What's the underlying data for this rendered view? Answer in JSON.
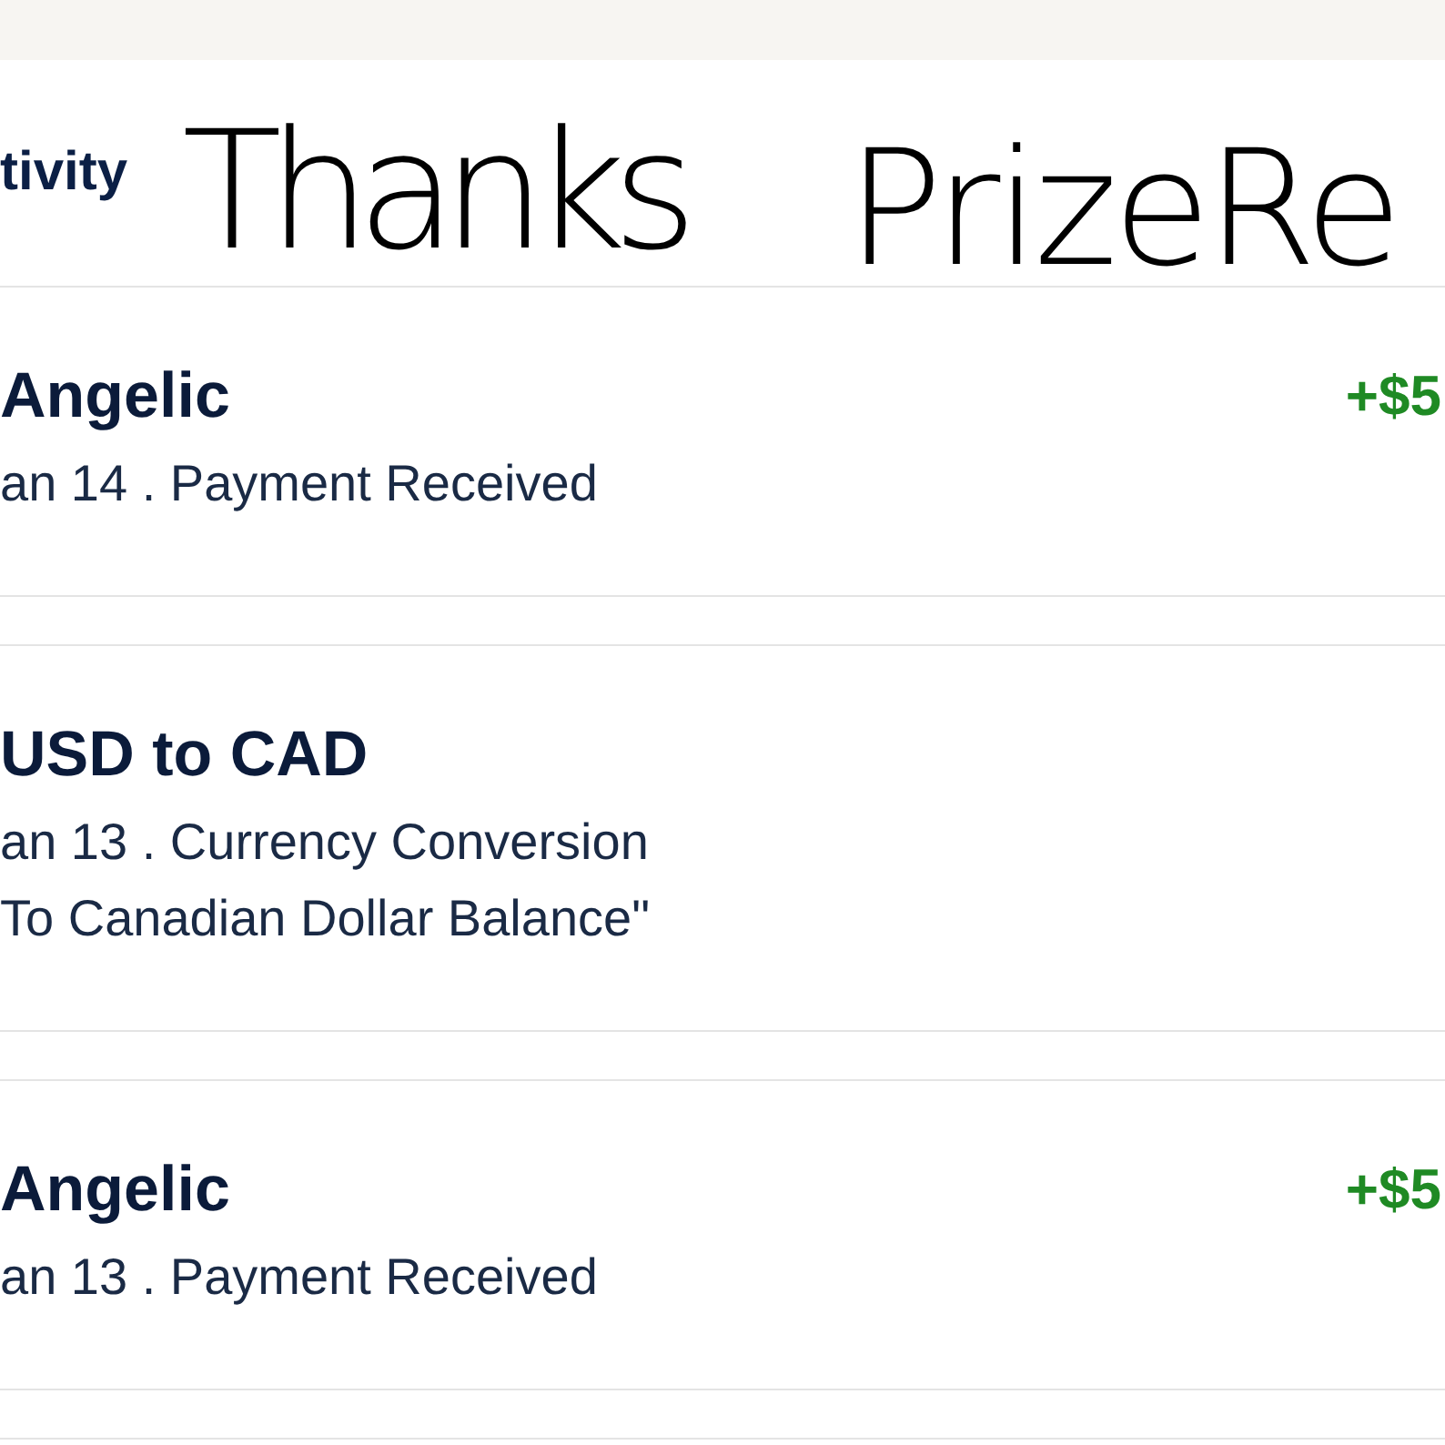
{
  "header": {
    "title": "tivity"
  },
  "handwriting": [
    {
      "text": "Thanks"
    },
    {
      "text": "PrizeRe"
    }
  ],
  "transactions": [
    {
      "name": "Angelic",
      "details": [
        "an 14 . Payment Received"
      ],
      "amount": "+$5"
    },
    {
      "name": "USD to CAD",
      "details": [
        "an 13 . Currency Conversion",
        "To Canadian Dollar Balance\""
      ]
    },
    {
      "name": "Angelic",
      "details": [
        "an 13 . Payment Received"
      ],
      "amount": "+$5"
    }
  ]
}
